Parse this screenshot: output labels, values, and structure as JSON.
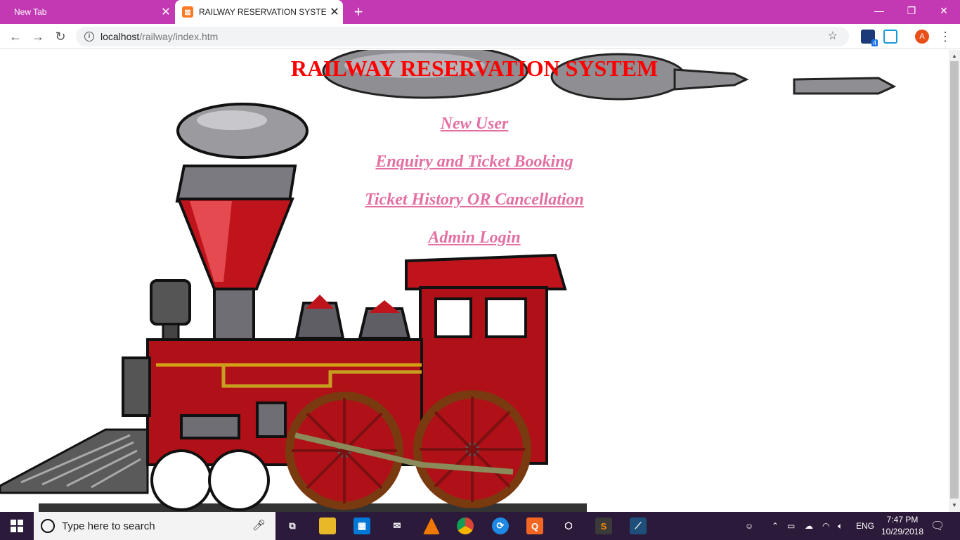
{
  "browser": {
    "tabs": [
      {
        "title": "New Tab",
        "close": "✕"
      },
      {
        "title": "RAILWAY RESERVATION SYSTEM",
        "close": "✕"
      }
    ],
    "new_tab": "+",
    "window_controls": {
      "minimize": "—",
      "restore": "❐",
      "close": "✕"
    },
    "address": {
      "host": "localhost",
      "path": "/railway/index.htm"
    },
    "extensions": {
      "badge": "4"
    },
    "avatar_letter": "A"
  },
  "page": {
    "heading": "RAILWAY RESERVATION SYSTEM",
    "links": [
      {
        "label": "New User "
      },
      {
        "label": "Enquiry and Ticket Booking "
      },
      {
        "label": "Ticket History OR Cancellation "
      },
      {
        "label": "Admin Login "
      }
    ],
    "image": "steam-locomotive"
  },
  "taskbar": {
    "search_placeholder": "Type here to search",
    "tray": {
      "language": "ENG",
      "time": "7:47 PM",
      "date": "10/29/2018"
    }
  },
  "colors": {
    "tabstrip": "#c239b3",
    "heading": "#ff0000",
    "link": "#e36fa3",
    "taskbar": "#2b1a3a"
  }
}
